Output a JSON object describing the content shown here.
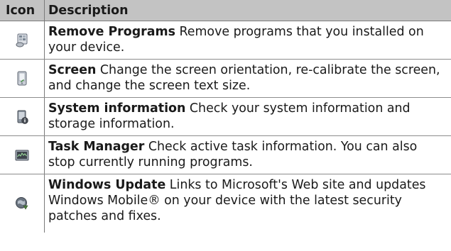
{
  "table": {
    "headers": {
      "icon": "Icon",
      "description": "Description"
    },
    "rows": [
      {
        "icon": "remove-programs-icon",
        "term": "Remove Programs",
        "text": " Remove programs that you installed on your device."
      },
      {
        "icon": "screen-icon",
        "term": "Screen",
        "text": " Change the screen orientation, re-calibrate the screen, and change the screen text size."
      },
      {
        "icon": "system-information-icon",
        "term": "System information",
        "text": " Check your system information and storage information."
      },
      {
        "icon": "task-manager-icon",
        "term": "Task Manager",
        "text": " Check active task information. You can also stop currently running programs."
      },
      {
        "icon": "windows-update-icon",
        "term": "Windows Update",
        "text": " Links to Microsoft's Web site and updates Windows Mobile® on your device with the latest security patches and fixes."
      }
    ]
  }
}
